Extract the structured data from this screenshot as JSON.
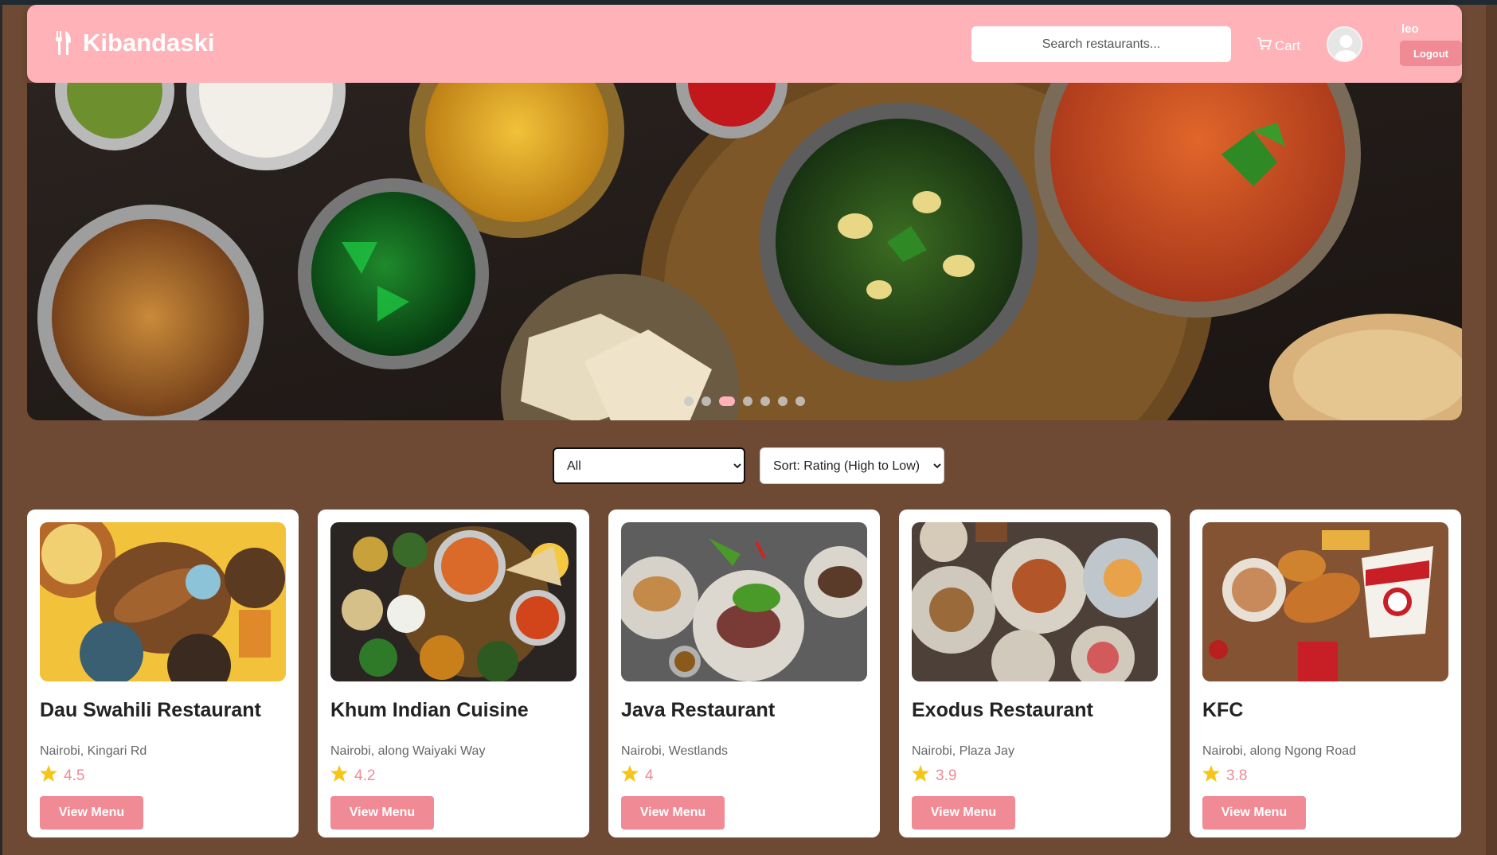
{
  "app": {
    "brand_name": "Kibandaski",
    "accent_color": "#ffb3b8",
    "button_color": "#f08a94",
    "page_background": "#6e4a34"
  },
  "header": {
    "search_placeholder": "Search restaurants...",
    "cart_label": "Cart",
    "cart_icon": "cart-icon",
    "user_name": "leo",
    "logout_label": "Logout"
  },
  "hero": {
    "slide_count": 7,
    "active_slide": 3
  },
  "filters": {
    "category_selected": "All",
    "sort_selected": "Sort: Rating (High to Low)"
  },
  "restaurants": [
    {
      "name": "Dau Swahili Restaurant",
      "location": "Nairobi, Kingari Rd",
      "rating": "4.5",
      "button": "View Menu"
    },
    {
      "name": "Khum Indian Cuisine",
      "location": "Nairobi, along Waiyaki Way",
      "rating": "4.2",
      "button": "View Menu"
    },
    {
      "name": "Java Restaurant",
      "location": "Nairobi, Westlands",
      "rating": "4",
      "button": "View Menu"
    },
    {
      "name": "Exodus Restaurant",
      "location": "Nairobi, Plaza Jay",
      "rating": "3.9",
      "button": "View Menu"
    },
    {
      "name": "KFC",
      "location": "Nairobi, along Ngong Road",
      "rating": "3.8",
      "button": "View Menu"
    }
  ]
}
